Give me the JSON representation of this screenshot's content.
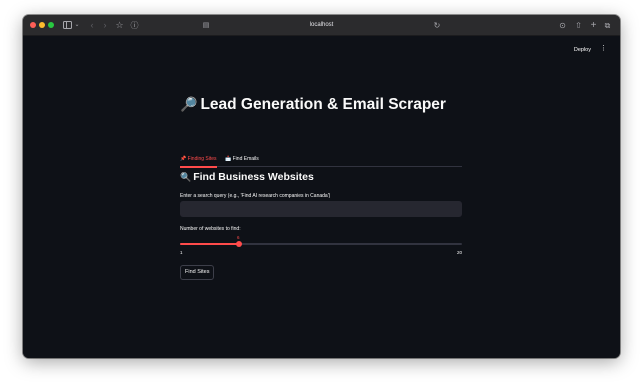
{
  "browser": {
    "url": "localhost",
    "icons": {
      "sidebar": "sidebar-icon",
      "back": "chevron-left-icon",
      "forward": "chevron-right-icon",
      "bookmark": "star-icon",
      "info": "info-icon",
      "reader": "reader-icon",
      "reload": "reload-icon",
      "download": "download-icon",
      "share": "share-icon",
      "new_tab": "plus-icon",
      "tabs": "tabs-icon"
    }
  },
  "app": {
    "deploy_label": "Deploy",
    "menu_glyph": "⋮",
    "title_emoji": "🔎",
    "title": "Lead Generation & Email Scraper",
    "tabs": [
      {
        "emoji": "📌",
        "label": "Finding Sites",
        "active": true
      },
      {
        "emoji": "📩",
        "label": "Find Emails",
        "active": false
      }
    ],
    "section": {
      "emoji": "🔍",
      "title": "Find Business Websites"
    },
    "query": {
      "label": "Enter a search query (e.g., 'Find AI research companies in Canada')",
      "value": "",
      "placeholder": ""
    },
    "slider": {
      "label": "Number of websites to find:",
      "value": "6",
      "min": "1",
      "max": "20"
    },
    "find_button_label": "Find Sites"
  },
  "colors": {
    "background": "#0e1117",
    "accent": "#ff4b4b",
    "input_bg": "#262730",
    "text": "#fafafa"
  }
}
